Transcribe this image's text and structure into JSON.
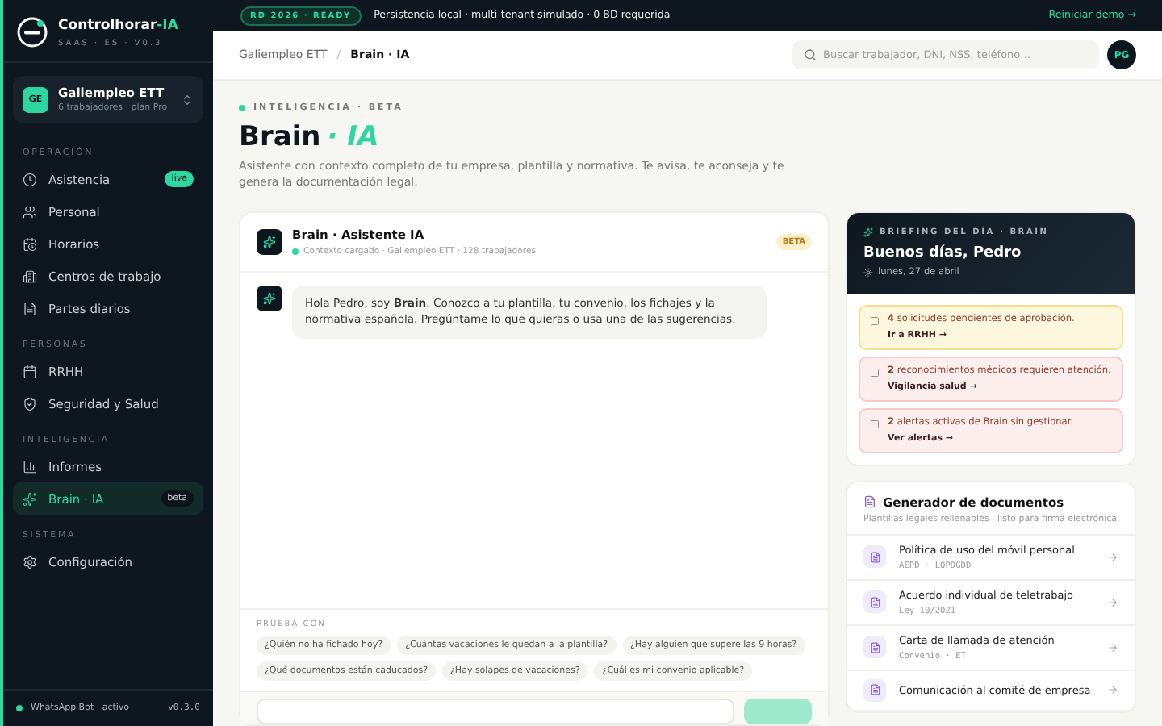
{
  "sidebar": {
    "brand": {
      "name": "Controlhorar",
      "accent": "-IA",
      "subtitle": "SAAS · ES · V0.3"
    },
    "org": {
      "initials": "GE",
      "name": "Galiempleo ETT",
      "detail": "6 trabajadores · plan Pro"
    },
    "sections": [
      {
        "title": "OPERACIÓN",
        "items": [
          {
            "label": "Asistencia",
            "badge": "live",
            "selected": false
          },
          {
            "label": "Personal",
            "selected": false
          },
          {
            "label": "Horarios",
            "selected": false
          },
          {
            "label": "Centros de trabajo",
            "selected": false
          },
          {
            "label": "Partes diarios",
            "selected": false
          }
        ]
      },
      {
        "title": "PERSONAS",
        "items": [
          {
            "label": "RRHH",
            "selected": false
          },
          {
            "label": "Seguridad y Salud",
            "selected": false
          }
        ]
      },
      {
        "title": "INTELIGENCIA",
        "items": [
          {
            "label": "Informes",
            "selected": false
          },
          {
            "label": "Brain · IA",
            "badge": "beta",
            "selected": true
          }
        ]
      },
      {
        "title": "SISTEMA",
        "items": [
          {
            "label": "Configuración",
            "selected": false
          }
        ]
      }
    ],
    "footer": {
      "status": "WhatsApp Bot · activo",
      "version": "v0.3.0"
    }
  },
  "top_bar": {
    "badge": "RD 2026 · READY",
    "message": "Persistencia local · multi-tenant simulado · 0 BD requerida",
    "link": "Reiniciar demo →"
  },
  "header": {
    "breadcrumbs": [
      "Galiempleo ETT",
      "Brain · IA"
    ],
    "breadcrumb_separator": "/",
    "search": {
      "placeholder": "Buscar trabajador, DNI, NSS, teléfono…"
    },
    "avatar": "PG"
  },
  "page": {
    "eyebrow": "INTELIGENCIA · BETA",
    "title": "Brain",
    "title_accent": "· IA",
    "description": "Asistente con contexto completo de tu empresa, plantilla y normativa. Te avisa, te aconseja y te genera la documentación legal."
  },
  "chat": {
    "title": "Brain · Asistente IA",
    "status": "Contexto cargado · Galiempleo ETT · 128 trabajadores",
    "badge": "BETA",
    "messages": [
      "Hola Pedro, soy **Brain**. Conozco a tu plantilla, tu convenio, los fichajes y la normativa española. Pregúntame lo que quieras o usa una de las sugerencias."
    ],
    "suggestions_label": "PRUEBA CON",
    "suggestions": [
      "¿Quién no ha fichado hoy?",
      "¿Cuántas vacaciones le quedan a la plantilla?",
      "¿Hay alguien que supere las 9 horas?",
      "¿Qué documentos están caducados?",
      "¿Hay solapes de vacaciones?",
      "¿Cuál es mi convenio aplicable?"
    ]
  },
  "briefing": {
    "eyebrow": "BRIEFING DEL DÍA · BRAIN",
    "greeting": "Buenos días, Pedro",
    "date": "lunes, 27 de abril",
    "alerts": [
      {
        "kind": "warning",
        "text": "**4** solicitudes pendientes de aprobación.",
        "link": "Ir a RRHH →"
      },
      {
        "kind": "danger",
        "text": "**2** reconocimientos médicos requieren atención.",
        "link": "Vigilancia salud →"
      },
      {
        "kind": "danger",
        "text": "**2** alertas activas de Brain sin gestionar.",
        "link": "Ver alertas →"
      }
    ]
  },
  "documents": {
    "title": "Generador de documentos",
    "subtitle": "Plantillas legales rellenables · listo para firma electrónica.",
    "items": [
      {
        "title": "Política de uso del móvil personal",
        "meta": "AEPD · LOPDGDD"
      },
      {
        "title": "Acuerdo individual de teletrabajo",
        "meta": "Ley 10/2021"
      },
      {
        "title": "Carta de llamada de atención",
        "meta": "Convenio · ET"
      },
      {
        "title": "Comunicación al comité de empresa"
      }
    ]
  }
}
